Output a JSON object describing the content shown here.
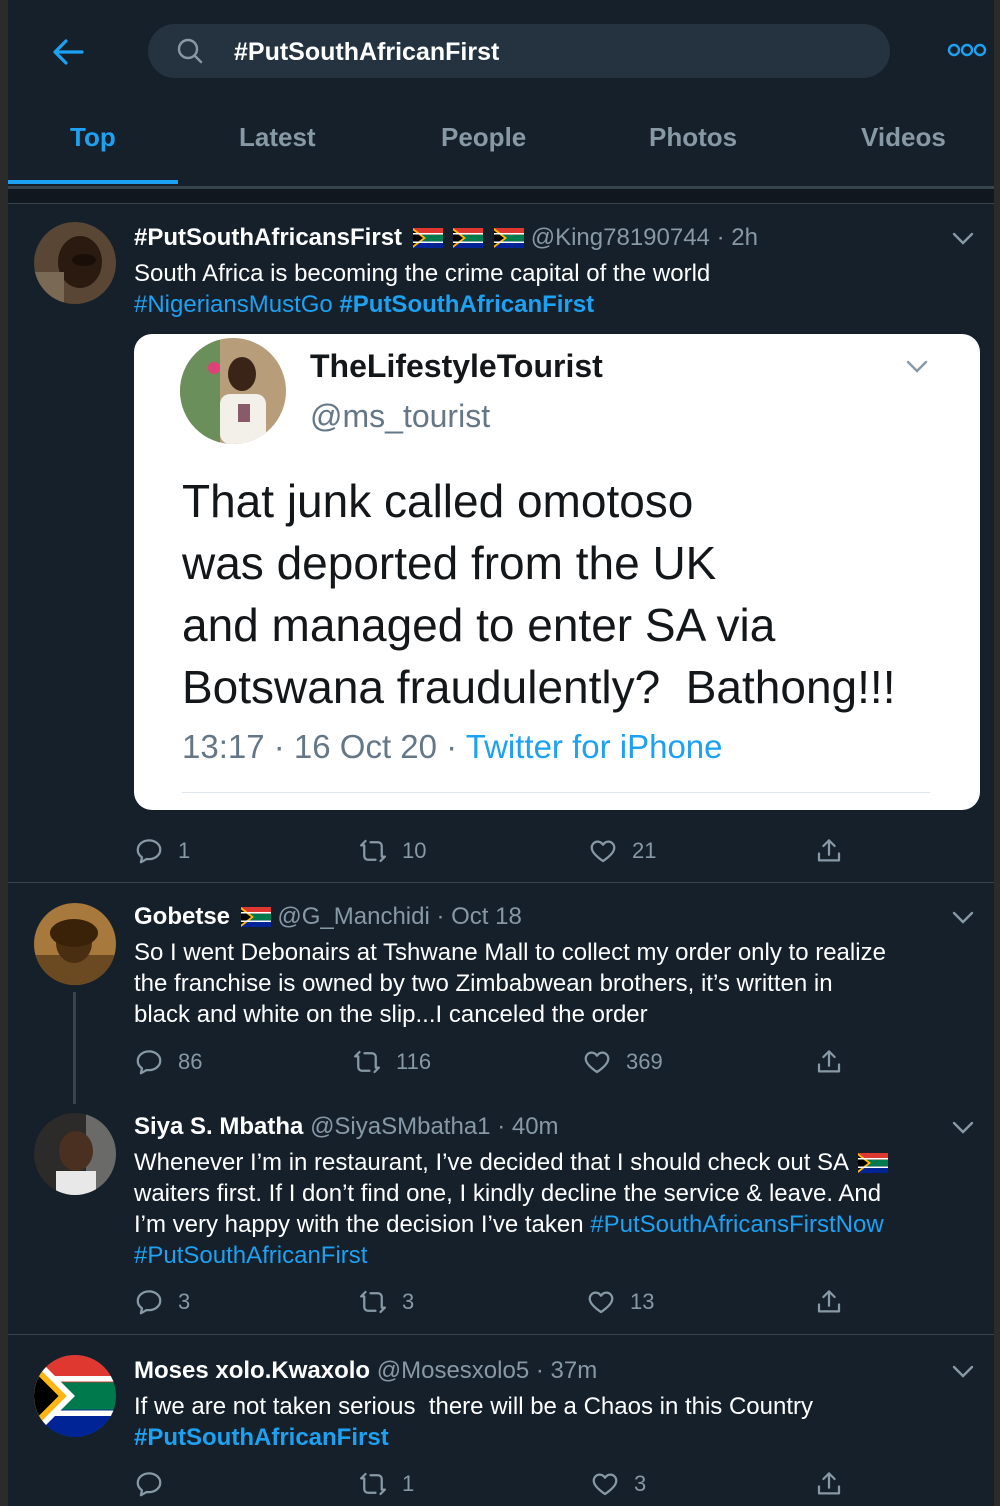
{
  "search": {
    "query": "#PutSouthAfricanFirst"
  },
  "tabs": [
    "Top",
    "Latest",
    "People",
    "Photos",
    "Videos"
  ],
  "icons": {
    "back": "back-arrow-icon",
    "search": "search-icon",
    "more": "more-icon",
    "reply": "reply-icon",
    "retweet": "retweet-icon",
    "like": "heart-icon",
    "share": "share-icon",
    "caret": "chevron-down-icon"
  },
  "colors": {
    "accent": "#1da1f2",
    "background": "#15202b",
    "muted": "#8899a6"
  },
  "tweets": [
    {
      "name": "#PutSouthAfricansFirst",
      "handle": "@King78190744",
      "time": "2h",
      "text": "South Africa is becoming the crime capital of the world",
      "tags": [
        "#NigeriansMustGo",
        "#PutSouthAfricanFirst"
      ],
      "quote": {
        "name": "TheLifestyleTourist",
        "handle": "@ms_tourist",
        "text_lines": [
          "That junk called omotoso",
          "was deported from the UK",
          "and managed to enter SA via",
          "Botswana fraudulently?  Bathong!!!"
        ],
        "time": "13:17 · 16 Oct 20 · ",
        "source": "Twitter for iPhone"
      },
      "replies": "1",
      "retweets": "10",
      "likes": "21"
    },
    {
      "name": "Gobetse",
      "handle": "@G_Manchidi",
      "time": "Oct 18",
      "text_lines": [
        "So I went Debonairs at Tshwane Mall to collect my order only to realize",
        "the franchise is owned by two Zimbabwean brothers, it’s written in",
        "black and white on the slip...I canceled the order"
      ],
      "replies": "86",
      "retweets": "116",
      "likes": "369"
    },
    {
      "name": "Siya S. Mbatha",
      "handle": "@SiyaSMbatha1",
      "time": "40m",
      "text_lines": [
        "Whenever I’m in restaurant, I’ve decided that I should check out SA",
        "waiters first. If I don’t find one, I kindly decline the service & leave. And",
        "I’m very happy with the decision I’ve taken "
      ],
      "tags": [
        "#PutSouthAfricansFirstNow",
        "#PutSouthAfricanFirst"
      ],
      "replies": "3",
      "retweets": "3",
      "likes": "13"
    },
    {
      "name": "Moses xolo.Kwaxolo",
      "handle": "@Mosesxolo5",
      "time": "37m",
      "text": "If we are not taken serious  there will be a Chaos in this Country",
      "tags": [
        "#PutSouthAfricanFirst"
      ],
      "replies": "",
      "retweets": "1",
      "likes": "3"
    }
  ]
}
